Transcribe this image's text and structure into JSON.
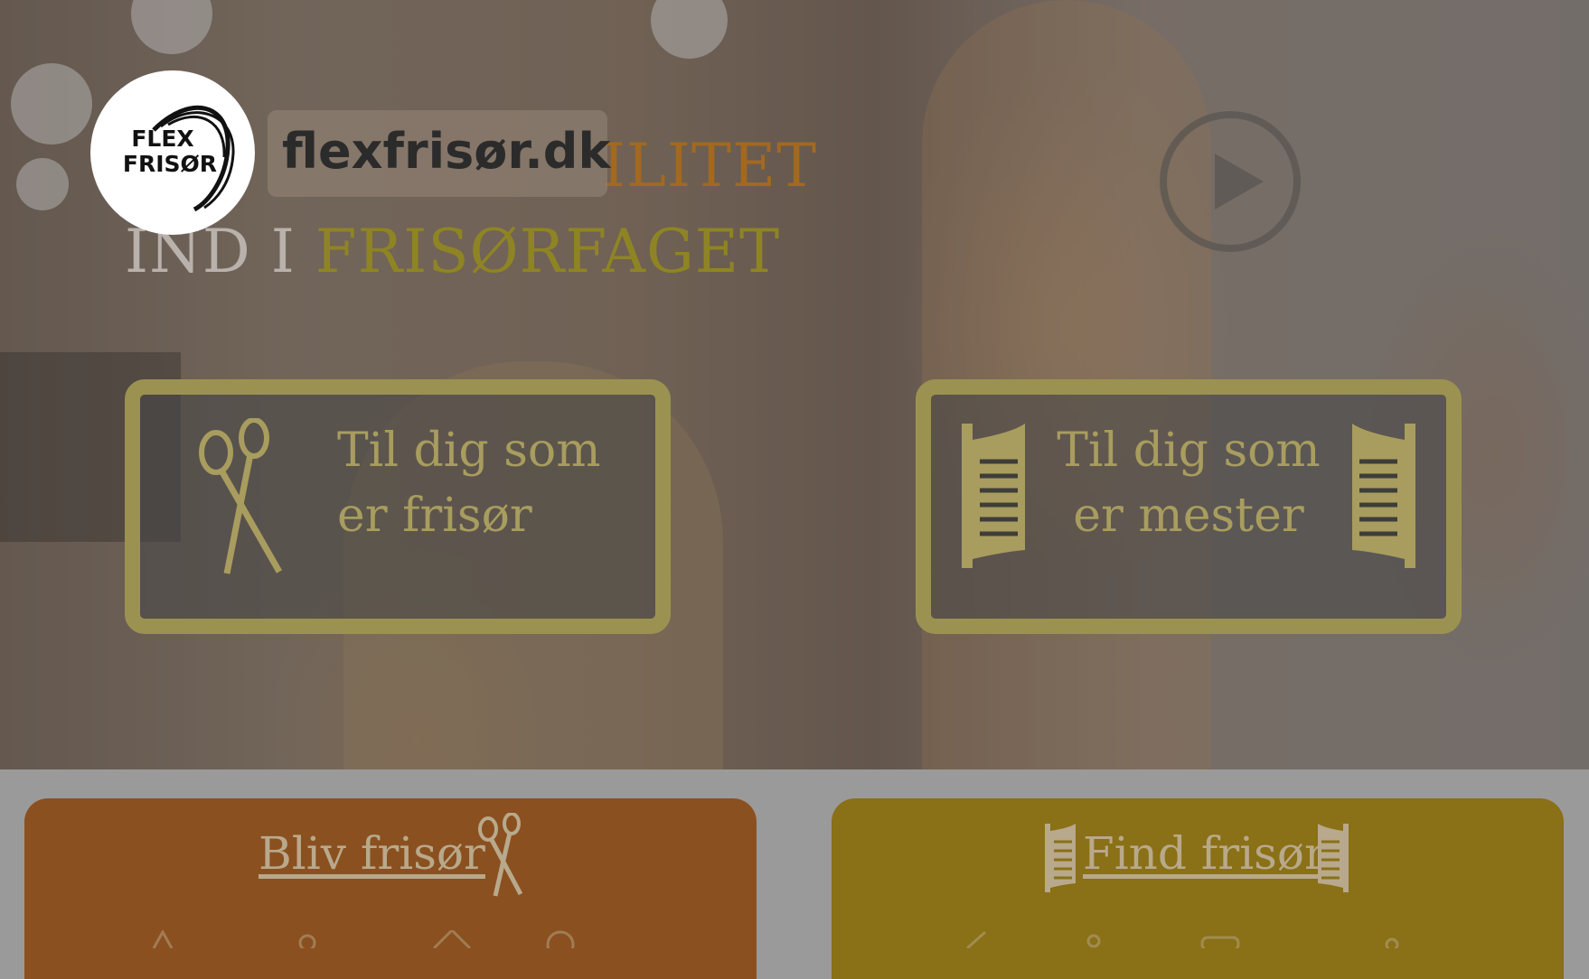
{
  "brand": {
    "logo_line1": "FLEX",
    "logo_line2": "FRISØR",
    "domain": "flexfrisør.dk"
  },
  "hero": {
    "headline_partial": "ILITET",
    "headline_line2_prefix": "IND I",
    "headline_line2_highlight": "FRISØRFAGET",
    "colors": {
      "headline_orange": "#a2691f",
      "headline_gold": "#8f8424",
      "headline_light": "#b9b1ab"
    }
  },
  "cards": [
    {
      "line1": "Til dig som",
      "line2": "er frisør",
      "icon": "scissors-icon"
    },
    {
      "line1": "Til dig som",
      "line2": "er mester",
      "icon": "saloon-door-icon"
    }
  ],
  "panels": [
    {
      "title": "Bliv frisør",
      "color": "#8b501f",
      "icon": "scissors-icon"
    },
    {
      "title": "Find frisør",
      "color": "#8a7016",
      "icon": "saloon-door-icon"
    }
  ],
  "colors": {
    "card_border": "#9b9252",
    "card_text": "#a89d5e",
    "page_bg": "#9a9a9a"
  }
}
